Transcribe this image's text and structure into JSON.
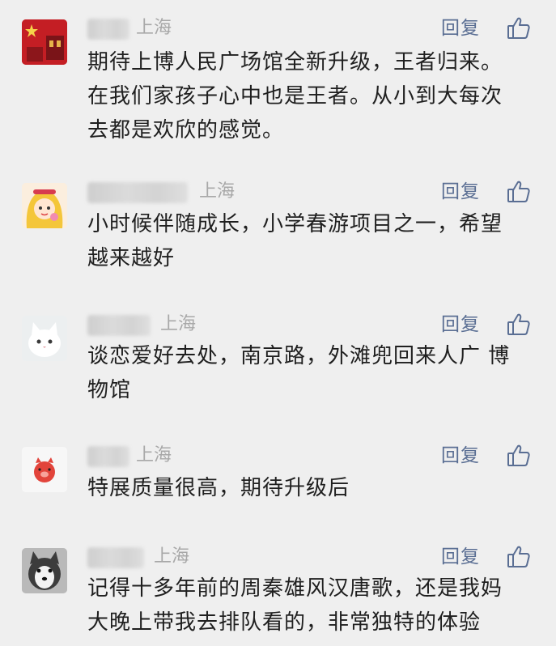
{
  "colors": {
    "background": "#efefef",
    "reply_link": "#5a6e93",
    "location": "#a8a8a8",
    "comment_text": "#1f1f1f"
  },
  "comments": [
    {
      "location": "上海",
      "reply_label": "回复",
      "like_icon": "thumbs-up-outline",
      "text": "期待上博人民广场馆全新升级，王者归来。\n在我们家孩子心中也是王者。从小到大每次\n去都是欢欣的感觉。"
    },
    {
      "location": "上海",
      "reply_label": "回复",
      "like_icon": "thumbs-up-outline",
      "text": "小时候伴随成长，小学春游项目之一，希望\n越来越好"
    },
    {
      "location": "上海",
      "reply_label": "回复",
      "like_icon": "thumbs-up-outline",
      "text": "谈恋爱好去处，南京路，外滩兜回来人广 博\n物馆"
    },
    {
      "location": "上海",
      "reply_label": "回复",
      "like_icon": "thumbs-up-outline",
      "text": "特展质量很高，期待升级后"
    },
    {
      "location": "上海",
      "reply_label": "回复",
      "like_icon": "thumbs-up-outline",
      "text": "记得十多年前的周秦雄风汉唐歌，还是我妈\n大晚上带我去排队看的，非常独特的体验"
    }
  ]
}
